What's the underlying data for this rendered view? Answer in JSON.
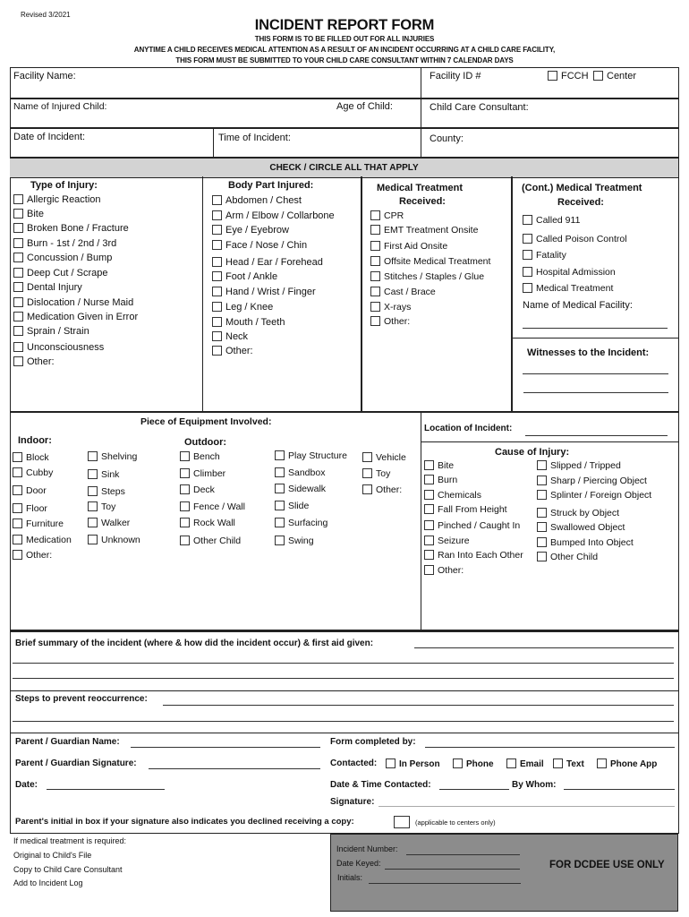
{
  "header": {
    "revised": "Revised 3/2021",
    "title": "INCIDENT REPORT FORM",
    "subtitle_lines": [
      "THIS FORM IS TO BE FILLED OUT FOR ALL INJURIES",
      "ANYTIME A CHILD RECEIVES MEDICAL ATTENTION AS A RESULT OF AN INCIDENT OCCURRING AT A CHILD CARE FACILITY,",
      "THIS FORM MUST BE SUBMITTED TO YOUR CHILD CARE CONSULTANT WITHIN 7 CALENDAR DAYS"
    ]
  },
  "info": {
    "facility_name": "Facility Name:",
    "facility_id": "Facility ID #",
    "fcch": "FCCH",
    "center": "Center",
    "child_name": "Name of Injured Child:",
    "child_age": "Age of Child:",
    "consultant": "Child Care Consultant:",
    "date": "Date of Incident:",
    "time": "Time of Incident:",
    "county": "County:"
  },
  "check_header": "CHECK / CIRCLE ALL THAT APPLY",
  "injury_type": {
    "title": "Type of Injury:",
    "items": [
      "Allergic Reaction",
      "Bite",
      "Broken Bone / Fracture",
      "Burn - 1st / 2nd / 3rd",
      "Concussion / Bump",
      "Deep Cut / Scrape",
      "Dental Injury",
      "Dislocation / Nurse Maid",
      "Medication Given in Error",
      "Sprain / Strain",
      "Unconsciousness",
      "Other:"
    ]
  },
  "body_part": {
    "title": "Body Part Injured:",
    "items": [
      "Abdomen / Chest",
      "Arm / Elbow / Collarbone",
      "Eye / Eyebrow",
      "Face / Nose / Chin",
      "Head / Ear / Forehead",
      "Foot / Ankle",
      "Hand / Wrist / Finger",
      "Leg / Knee",
      "Mouth / Teeth",
      "Neck",
      "Other:"
    ]
  },
  "medical": {
    "title1": "Medical Treatment",
    "title2": "Received:",
    "items": [
      "CPR",
      "EMT Treatment Onsite",
      "First Aid Onsite",
      "Offsite Medical Treatment",
      "Stitches / Staples / Glue",
      "Cast / Brace",
      "X-rays",
      "Other:"
    ]
  },
  "medical_cont": {
    "title1": "(Cont.) Medical Treatment",
    "title2": "Received:",
    "items": [
      "Called 911",
      "Called Poison Control",
      "Fatality",
      "Hospital Admission",
      "Medical Treatment"
    ],
    "facility_label": "Name of Medical Facility:",
    "witnesses_label": "Witnesses to the Incident:"
  },
  "equipment": {
    "title": "Piece of Equipment Involved:",
    "indoor_label": "Indoor:",
    "outdoor_label": "Outdoor:",
    "indoor_col1": [
      "Block",
      "Cubby",
      "Door",
      "Floor",
      "Furniture",
      "Medication",
      "Other:"
    ],
    "indoor_col2": [
      "Shelving",
      "Sink",
      "Steps",
      "Toy",
      "Walker",
      "Unknown"
    ],
    "outdoor_col1": [
      "Bench",
      "Climber",
      "Deck",
      "Fence / Wall",
      "Rock Wall",
      "Other Child"
    ],
    "outdoor_col2": [
      "Play Structure",
      "Sandbox",
      "Sidewalk",
      "Slide",
      "Surfacing",
      "Swing"
    ],
    "outdoor_col3": [
      "Vehicle",
      "Toy",
      "Other:"
    ]
  },
  "location": {
    "label": "Location of Incident:"
  },
  "cause": {
    "title": "Cause of Injury:",
    "col1": [
      "Bite",
      "Burn",
      "Chemicals",
      "Fall From Height",
      "Pinched / Caught In",
      "Seizure",
      "Ran Into Each Other",
      "Other:"
    ],
    "col2": [
      "Slipped / Tripped",
      "Sharp / Piercing Object",
      "Splinter / Foreign Object",
      "Struck by Object",
      "Swallowed Object",
      "Bumped Into Object",
      "Other Child"
    ]
  },
  "summary": {
    "brief_label": "Brief summary of the incident (where & how did the incident occur) & first aid given:",
    "steps_label": "Steps to prevent reoccurrence:"
  },
  "parent": {
    "name": "Parent / Guardian Name:",
    "signature": "Parent / Guardian Signature:",
    "date": "Date:",
    "completed_by": "Form completed by:",
    "contacted": "Contacted:",
    "contact_options": [
      "In Person",
      "Phone",
      "Email",
      "Text",
      "Phone App"
    ],
    "date_time_contacted": "Date & Time Contacted:",
    "by_whom": "By Whom:",
    "sig2": "Signature:",
    "initial_note": "Parent's initial in box if your signature also indicates you declined receiving a copy:",
    "applicable": "(applicable to centers only)"
  },
  "footer": {
    "notes": [
      "If medical treatment is required:",
      "Original to Child's File",
      "Copy to Child Care Consultant",
      "Add to Incident Log"
    ],
    "incident_number": "Incident Number:",
    "date_keyed": "Date Keyed:",
    "initials": "Initials:",
    "dcdee": "FOR DCDEE USE ONLY"
  }
}
